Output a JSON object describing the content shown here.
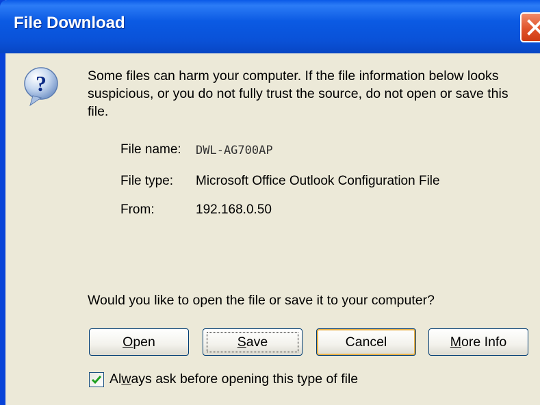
{
  "window": {
    "title": "File Download"
  },
  "warning": "Some files can harm your computer. If the file information below looks suspicious, or you do not fully trust the source, do not open or save this file.",
  "file_info": [
    {
      "label": "File name:",
      "value": "DWL-AG700AP"
    },
    {
      "label": "File type:",
      "value": "Microsoft Office Outlook Configuration File"
    },
    {
      "label": "From:",
      "value": "192.168.0.50"
    }
  ],
  "question": "Would you like to open the file or save it to your computer?",
  "buttons": {
    "open": {
      "accel": "O",
      "rest": "pen"
    },
    "save": {
      "accel": "S",
      "rest": "ave"
    },
    "cancel": {
      "label": "Cancel"
    },
    "more_info": {
      "accel": "M",
      "rest": "ore Info"
    }
  },
  "checkbox": {
    "checked": true,
    "pre": "Al",
    "accel": "w",
    "post": "ays ask before opening this type of file"
  },
  "icons": {
    "help": "question-mark-icon",
    "close": "close-x-icon",
    "check": "checkmark-icon"
  }
}
